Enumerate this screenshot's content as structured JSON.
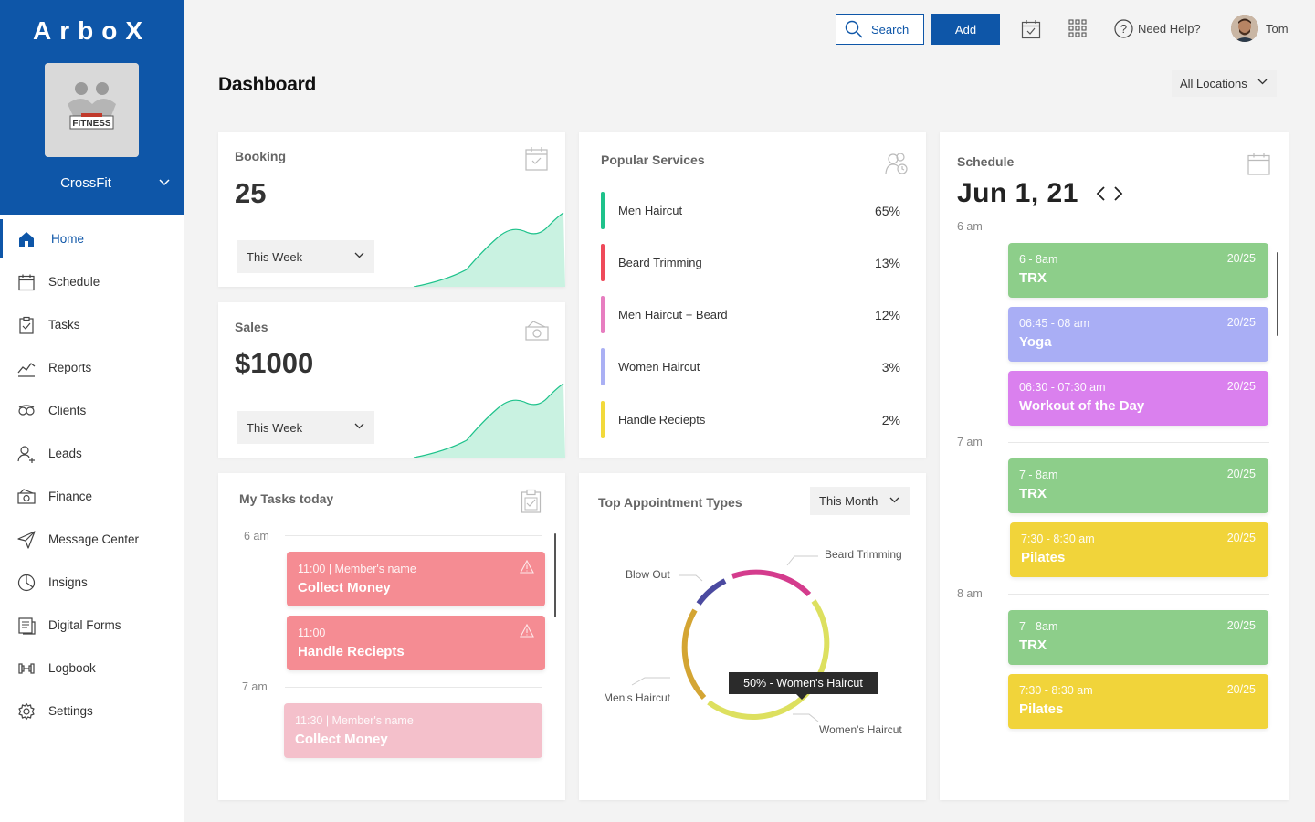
{
  "brand": {
    "logo": "ArboX",
    "gym_name": "CrossFit"
  },
  "nav": [
    {
      "label": "Home",
      "icon": "home-icon",
      "active": true
    },
    {
      "label": "Schedule",
      "icon": "calendar-icon"
    },
    {
      "label": "Tasks",
      "icon": "clipboard-icon"
    },
    {
      "label": "Reports",
      "icon": "chart-line-icon"
    },
    {
      "label": "Clients",
      "icon": "clients-icon"
    },
    {
      "label": "Leads",
      "icon": "user-plus-icon"
    },
    {
      "label": "Finance",
      "icon": "money-icon"
    },
    {
      "label": "Message Center",
      "icon": "paper-plane-icon"
    },
    {
      "label": "Insigns",
      "icon": "pie-icon"
    },
    {
      "label": "Digital Forms",
      "icon": "form-icon"
    },
    {
      "label": "Logbook",
      "icon": "dumbbell-icon"
    },
    {
      "label": "Settings",
      "icon": "gear-icon"
    }
  ],
  "topbar": {
    "search_label": "Search",
    "add_label": "Add",
    "help_label": "Need Help?",
    "user_name": "Tom"
  },
  "page": {
    "title": "Dashboard",
    "location_filter": "All Locations"
  },
  "booking": {
    "title": "Booking",
    "value": "25",
    "period": "This Week"
  },
  "sales": {
    "title": "Sales",
    "value": "$1000",
    "period": "This Week"
  },
  "popular": {
    "title": "Popular Services",
    "items": [
      {
        "name": "Men Haircut",
        "pct": "65%",
        "color": "#1ec28b"
      },
      {
        "name": "Beard Trimming",
        "pct": "13%",
        "color": "#ef4a5a"
      },
      {
        "name": "Men Haircut + Beard",
        "pct": "12%",
        "color": "#e77ec0"
      },
      {
        "name": "Women Haircut",
        "pct": "3%",
        "color": "#aab0f4"
      },
      {
        "name": "Handle Reciepts",
        "pct": "2%",
        "color": "#f2d93b"
      }
    ]
  },
  "tasks": {
    "title": "My Tasks today",
    "times": [
      "6 am",
      "7 am"
    ],
    "items": [
      {
        "line1": "11:00 | Member's name",
        "line2": "Collect Money"
      },
      {
        "line1": "11:00",
        "line2": "Handle Reciepts"
      },
      {
        "line1": "11:30 | Member's name",
        "line2": "Collect Money"
      }
    ]
  },
  "appointments": {
    "title": "Top Appointment Types",
    "period": "This Month",
    "labels": {
      "blow_out": "Blow Out",
      "beard": "Beard Trimming",
      "men": "Men's Haircut",
      "women": "Women's Haircut"
    },
    "tooltip": "50% - Women's Haircut"
  },
  "schedule": {
    "title": "Schedule",
    "date": "Jun 1, 21",
    "hours": [
      "6 am",
      "7 am",
      "8 am"
    ],
    "events": [
      {
        "time": "6 - 8am",
        "name": "TRX",
        "count": "20/25",
        "color": "#8dce8a"
      },
      {
        "time": "06:45 - 08 am",
        "name": "Yoga",
        "count": "20/25",
        "color": "#a9aef5"
      },
      {
        "time": "06:30 - 07:30 am",
        "name": "Workout of the Day",
        "count": "20/25",
        "color": "#da80ee"
      },
      {
        "time": "7 - 8am",
        "name": "TRX",
        "count": "20/25",
        "color": "#8dce8a"
      },
      {
        "time": "7:30 - 8:30 am",
        "name": "Pilates",
        "count": "20/25",
        "color": "#f1d43a"
      },
      {
        "time": "7 - 8am",
        "name": "TRX",
        "count": "20/25",
        "color": "#8dce8a"
      },
      {
        "time": "7:30 - 8:30 am",
        "name": "Pilates",
        "count": "20/25",
        "color": "#f1d43a"
      }
    ]
  }
}
